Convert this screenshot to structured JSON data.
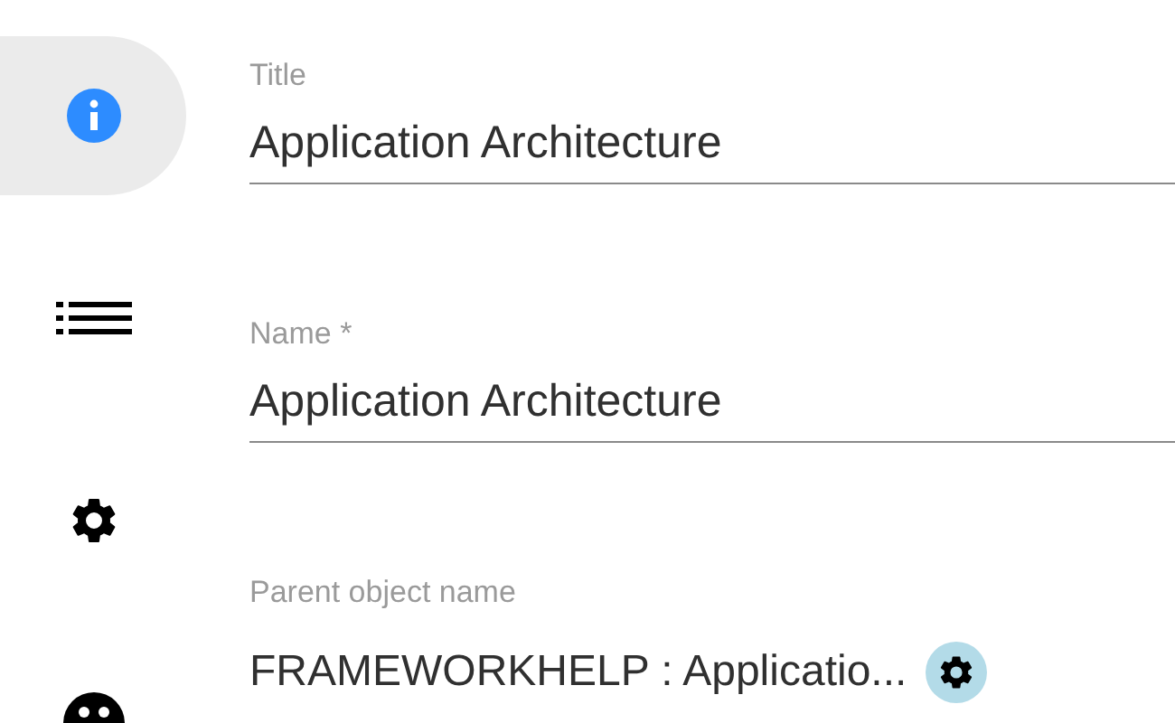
{
  "sidebar": {
    "items": [
      {
        "kind": "info",
        "selected": true
      },
      {
        "kind": "list",
        "selected": false
      },
      {
        "kind": "gear",
        "selected": false
      },
      {
        "kind": "face",
        "selected": false
      }
    ]
  },
  "fields": [
    {
      "kind": "input",
      "label": "Title",
      "value": "Application Architecture"
    },
    {
      "kind": "input",
      "label": "Name *",
      "value": "Application Architecture"
    },
    {
      "kind": "reference",
      "label": "Parent object name",
      "value": "FRAMEWORKHELP : Applicatio..."
    }
  ]
}
